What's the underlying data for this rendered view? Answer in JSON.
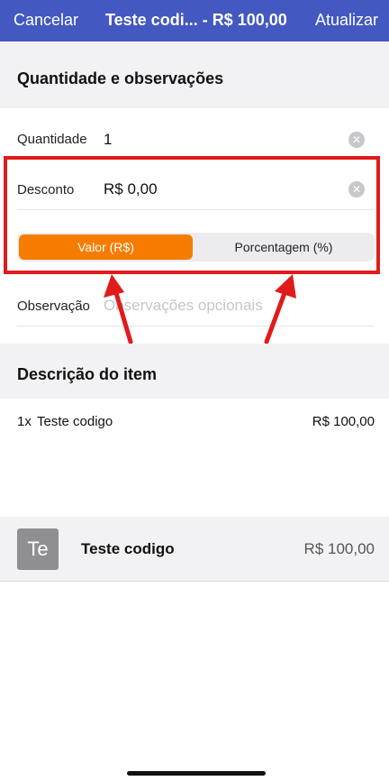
{
  "navbar": {
    "cancel": "Cancelar",
    "title": "Teste codi... - R$ 100,00",
    "update": "Atualizar",
    "color": "#4358c0"
  },
  "section_quantity": {
    "title": "Quantidade e observações"
  },
  "quantity": {
    "label": "Quantidade",
    "value": "1",
    "clear_icon": "clear-circle-icon"
  },
  "discount": {
    "label": "Desconto",
    "value": "R$ 0,00",
    "clear_icon": "clear-circle-icon",
    "segments": [
      {
        "label": "Valor (R$)",
        "selected": true
      },
      {
        "label": "Porcentagem (%)",
        "selected": false
      }
    ],
    "accent": "#f57c00"
  },
  "observation": {
    "label": "Observação",
    "placeholder": "Observações opcionais"
  },
  "section_item": {
    "title": "Descrição do item"
  },
  "item_lines": [
    {
      "qty": "1x",
      "name": "Teste codigo",
      "price": "R$ 100,00"
    }
  ],
  "product": {
    "thumb_text": "Te",
    "name": "Teste codigo",
    "price": "R$ 100,00"
  },
  "annotation": {
    "color": "#e01b1b"
  }
}
